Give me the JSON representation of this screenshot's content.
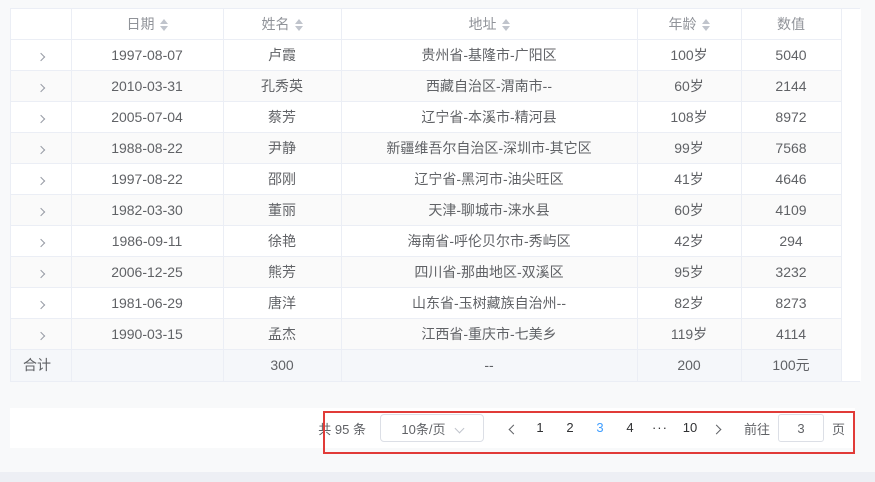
{
  "colors": {
    "accent": "#409eff",
    "annotation": "#e13b38",
    "header_text": "#909399",
    "body_text": "#606266",
    "stripe_bg": "#fafafa",
    "summary_bg": "#f5f7fa",
    "border": "#ebeef5"
  },
  "table": {
    "columns": [
      {
        "key": "expand",
        "label": "",
        "sortable": false
      },
      {
        "key": "date",
        "label": "日期",
        "sortable": true
      },
      {
        "key": "name",
        "label": "姓名",
        "sortable": true
      },
      {
        "key": "address",
        "label": "地址",
        "sortable": true
      },
      {
        "key": "age",
        "label": "年龄",
        "sortable": true
      },
      {
        "key": "value",
        "label": "数值",
        "sortable": false
      }
    ],
    "rows": [
      {
        "date": "1997-08-07",
        "name": "卢霞",
        "address": "贵州省-基隆市-广阳区",
        "age": "100岁",
        "value": "5040"
      },
      {
        "date": "2010-03-31",
        "name": "孔秀英",
        "address": "西藏自治区-渭南市--",
        "age": "60岁",
        "value": "2144"
      },
      {
        "date": "2005-07-04",
        "name": "蔡芳",
        "address": "辽宁省-本溪市-精河县",
        "age": "108岁",
        "value": "8972"
      },
      {
        "date": "1988-08-22",
        "name": "尹静",
        "address": "新疆维吾尔自治区-深圳市-其它区",
        "age": "99岁",
        "value": "7568"
      },
      {
        "date": "1997-08-22",
        "name": "邵刚",
        "address": "辽宁省-黑河市-油尖旺区",
        "age": "41岁",
        "value": "4646"
      },
      {
        "date": "1982-03-30",
        "name": "董丽",
        "address": "天津-聊城市-涞水县",
        "age": "60岁",
        "value": "4109"
      },
      {
        "date": "1986-09-11",
        "name": "徐艳",
        "address": "海南省-呼伦贝尔市-秀屿区",
        "age": "42岁",
        "value": "294"
      },
      {
        "date": "2006-12-25",
        "name": "熊芳",
        "address": "四川省-那曲地区-双溪区",
        "age": "95岁",
        "value": "3232"
      },
      {
        "date": "1981-06-29",
        "name": "唐洋",
        "address": "山东省-玉树藏族自治州--",
        "age": "82岁",
        "value": "8273"
      },
      {
        "date": "1990-03-15",
        "name": "孟杰",
        "address": "江西省-重庆市-七美乡",
        "age": "119岁",
        "value": "4114"
      }
    ],
    "summary": {
      "label": "合计",
      "date": "",
      "name": "300",
      "address": "--",
      "age": "200",
      "value": "100元"
    }
  },
  "pagination": {
    "total_text": "共 95 条",
    "page_size": "10条/页",
    "pages": [
      "1",
      "2",
      "3",
      "4",
      "···",
      "10"
    ],
    "active_page": "3",
    "ellipsis_label": "···",
    "jumper": {
      "prefix": "前往",
      "value": "3",
      "suffix": "页"
    }
  }
}
